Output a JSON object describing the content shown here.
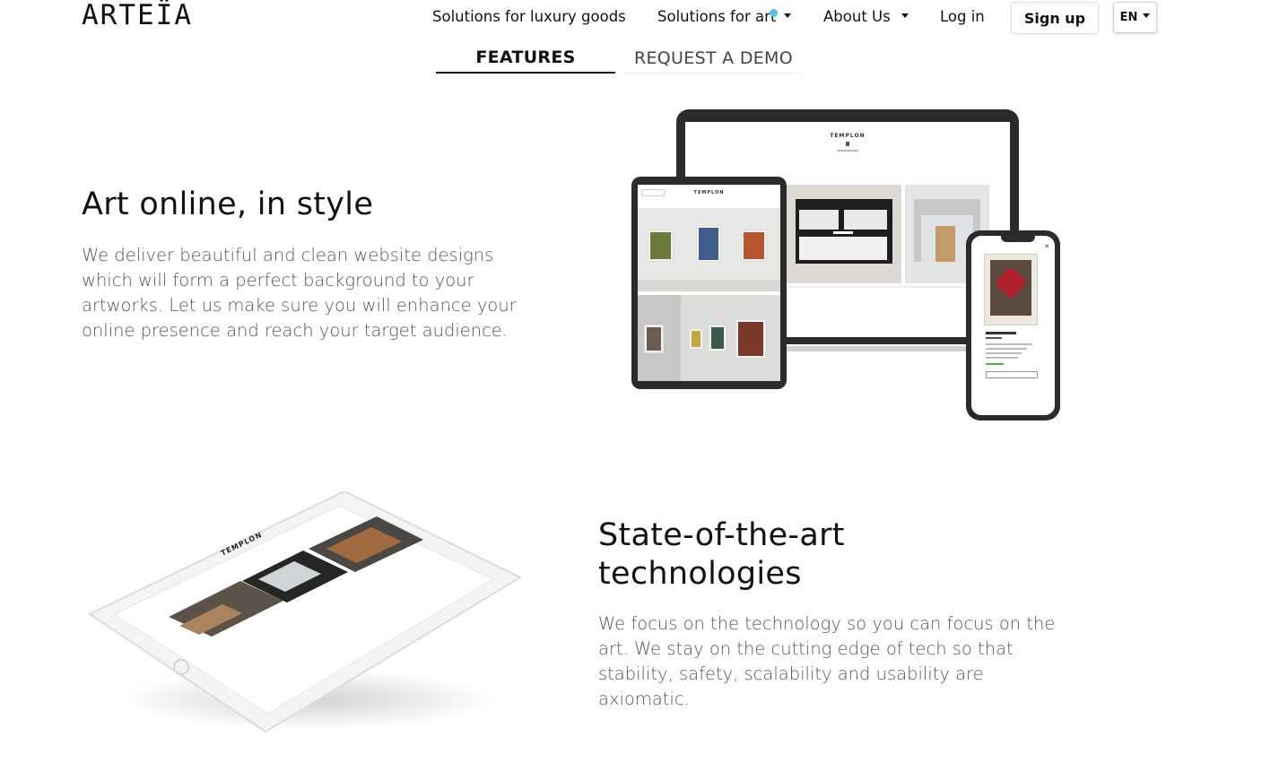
{
  "header": {
    "logo": "ARTEÏA",
    "nav": {
      "luxury": "Solutions for luxury goods",
      "art": "Solutions for art",
      "about": "About Us",
      "login": "Log in",
      "signup": "Sign up",
      "lang": "EN"
    }
  },
  "tabs": {
    "features": "FEATURES",
    "demo": "REQUEST A DEMO"
  },
  "section1": {
    "title": "Art online, in style",
    "text": "We deliver beautiful and clean website designs which will form a perfect background to your artworks. Let us make sure you will enhance your online presence and reach your target audience."
  },
  "section2": {
    "title": "State-of-the-art technologies",
    "text": "We focus on the technology so you can focus on the art. We stay on the cutting edge of tech so that stability, safety, scalability and usability are axiomatic."
  },
  "mockup": {
    "brand": "TEMPLON"
  },
  "colors": {
    "accent_dot": "#56c2e6",
    "text": "#111111",
    "body_text": "#555555"
  }
}
